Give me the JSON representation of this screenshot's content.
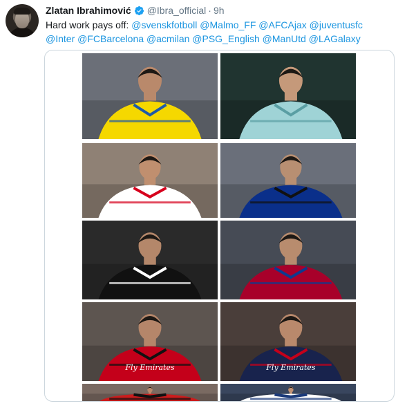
{
  "tweet": {
    "author": {
      "display_name": "Zlatan Ibrahimović",
      "handle": "@Ibra_official",
      "separator": "·",
      "time": "9h"
    },
    "text_prefix": "Hard work pays off: ",
    "mentions": [
      "@svenskfotboll",
      "@Malmo_FF",
      "@AFCAjax",
      "@juventusfc",
      "@Inter",
      "@FCBarcelona",
      "@acmilan",
      "@PSG_English",
      "@ManUtd",
      "@LAGalaxy"
    ],
    "media": {
      "tiles": [
        {
          "jersey": "#f5d800",
          "accent": "#1e5aa8",
          "bg": "#6b6f78",
          "tone": "#b9896b",
          "text": ""
        },
        {
          "jersey": "#9fd3d6",
          "accent": "#5a9ea3",
          "bg": "#203430",
          "tone": "#c5997a",
          "text": ""
        },
        {
          "jersey": "#ffffff",
          "accent": "#d6001c",
          "bg": "#8f8175",
          "tone": "#c08f6f",
          "text": ""
        },
        {
          "jersey": "#0a2f8a",
          "accent": "#111111",
          "bg": "#6a6f7a",
          "tone": "#b88f72",
          "text": ""
        },
        {
          "jersey": "#111111",
          "accent": "#ffffff",
          "bg": "#2a2a2a",
          "tone": "#b4876a",
          "text": ""
        },
        {
          "jersey": "#a8002a",
          "accent": "#0d3a8e",
          "bg": "#464b55",
          "tone": "#b88c6e",
          "text": ""
        },
        {
          "jersey": "#c4001a",
          "accent": "#111111",
          "bg": "#5d5550",
          "tone": "#b5866a",
          "text": "Fly Emirates"
        },
        {
          "jersey": "#18234d",
          "accent": "#c4001a",
          "bg": "#4a3e3a",
          "tone": "#b9896c",
          "text": "Fly Emirates"
        },
        {
          "jersey": "#cc1c1c",
          "accent": "#111111",
          "bg": "#7a6a62",
          "tone": "#b88a6d",
          "text": ""
        },
        {
          "jersey": "#ffffff",
          "accent": "#1b3a7a",
          "bg": "#39465e",
          "tone": "#c09275",
          "text": ""
        }
      ]
    }
  },
  "colors": {
    "link": "#1b95e0",
    "text": "#14171a",
    "secondary": "#657786",
    "verified": "#1da1f2",
    "border": "#ccd6dd"
  },
  "icons": {
    "verified": "verified-badge-icon"
  }
}
